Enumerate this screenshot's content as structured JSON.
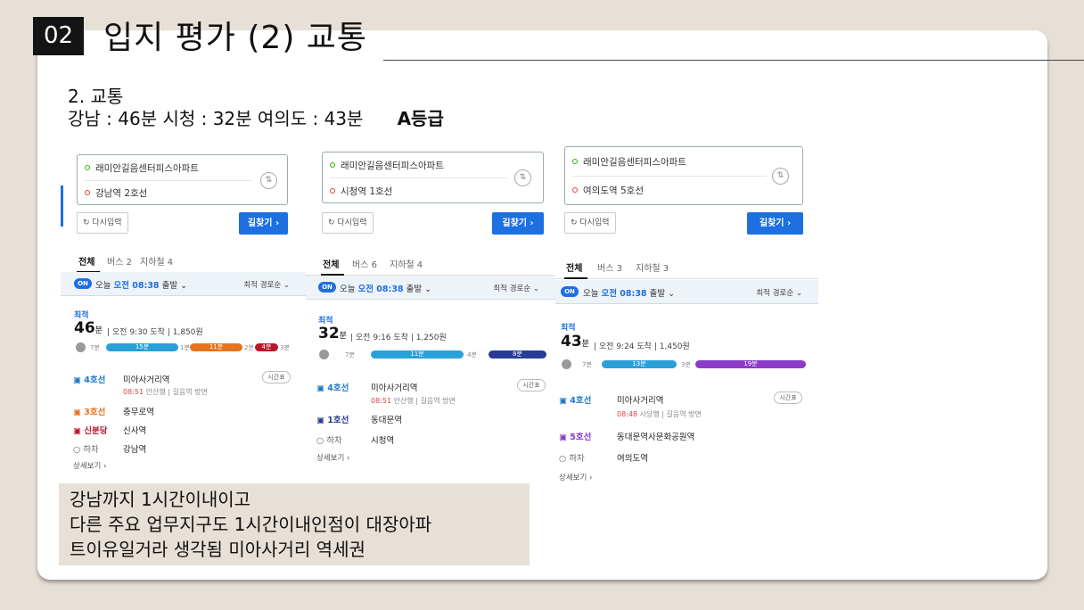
{
  "slide": {
    "number": "02",
    "title": "입지 평가 (2) 교통",
    "heading": "2. 교통",
    "summary": "강남 : 46분 시청 : 32분 여의도 : 43분",
    "grade": "A등급"
  },
  "routes": [
    {
      "from": "래미안길음센터피스아파트",
      "to": "강남역 2호선",
      "reset": "다시입력",
      "find": "길찾기",
      "tabs": [
        "전체",
        "버스 2",
        "지하철 4"
      ],
      "on": "ON",
      "depart_prefix": "오늘",
      "depart": "오전 08:38",
      "depart_suffix": "출발",
      "sort": "최적 경로순",
      "best": "최적",
      "minutes": "46",
      "unit": "분",
      "arrive": "오전 9:30 도착",
      "fare": "1,850원",
      "segments": {
        "w1": "7분",
        "s1": "15분",
        "t1": "1분",
        "s2": "11분",
        "t2": "2분",
        "s3": "4분",
        "w2": "3분"
      },
      "steps": [
        {
          "line": "4호선",
          "station": "미아사거리역",
          "time": "08:51",
          "dir": "안산행",
          "side": "길음역 방면",
          "btn": "시간표"
        },
        {
          "line": "3호선",
          "station": "충무로역"
        },
        {
          "line": "신분당",
          "station": "신사역"
        },
        {
          "line": "하차",
          "station": "강남역"
        }
      ],
      "more": "상세보기"
    },
    {
      "from": "래미안길음센터피스아파트",
      "to": "시청역 1호선",
      "reset": "다시입력",
      "find": "길찾기",
      "tabs": [
        "전체",
        "버스 6",
        "지하철 4"
      ],
      "on": "ON",
      "depart_prefix": "오늘",
      "depart": "오전 08:38",
      "depart_suffix": "출발",
      "sort": "최적 경로순",
      "best": "최적",
      "minutes": "32",
      "unit": "분",
      "arrive": "오전 9:16 도착",
      "fare": "1,250원",
      "segments": {
        "w1": "7분",
        "s1": "11분",
        "t1": "4분",
        "s2": "8분"
      },
      "steps": [
        {
          "line": "4호선",
          "station": "미아사거리역",
          "time": "08:51",
          "dir": "안산행",
          "side": "길음역 방면",
          "btn": "시간표"
        },
        {
          "line": "1호선",
          "station": "동대문역"
        },
        {
          "line": "하차",
          "station": "시청역"
        }
      ],
      "more": "상세보기"
    },
    {
      "from": "래미안길음센터피스아파트",
      "to": "여의도역 5호선",
      "reset": "다시입력",
      "find": "길찾기",
      "tabs": [
        "전체",
        "버스 3",
        "지하철 3"
      ],
      "on": "ON",
      "depart_prefix": "오늘",
      "depart": "오전 08:38",
      "depart_suffix": "출발",
      "sort": "최적 경로순",
      "best": "최적",
      "minutes": "43",
      "unit": "분",
      "arrive": "오전 9:24 도착",
      "fare": "1,450원",
      "segments": {
        "w1": "7분",
        "s1": "13분",
        "t1": "3분",
        "s2": "19분"
      },
      "steps": [
        {
          "line": "4호선",
          "station": "미아사거리역",
          "time": "08:48",
          "dir": "사당행",
          "side": "길음역 방면",
          "btn": "시간표"
        },
        {
          "line": "5호선",
          "station": "동대문역사문화공원역"
        },
        {
          "line": "하차",
          "station": "여의도역"
        }
      ],
      "more": "상세보기"
    }
  ],
  "note": [
    "강남까지 1시간이내이고",
    "다른 주요 업무지구도 1시간이내인점이 대장아파",
    "트이유일거라 생각됨 미아사거리 역세권"
  ],
  "colors": {
    "line4": "#2aa0d8",
    "line3": "#e8731e",
    "sinbundang": "#b8172c",
    "line1": "#263c96",
    "line5": "#8c3bc8",
    "accent": "#1e6fe0"
  }
}
